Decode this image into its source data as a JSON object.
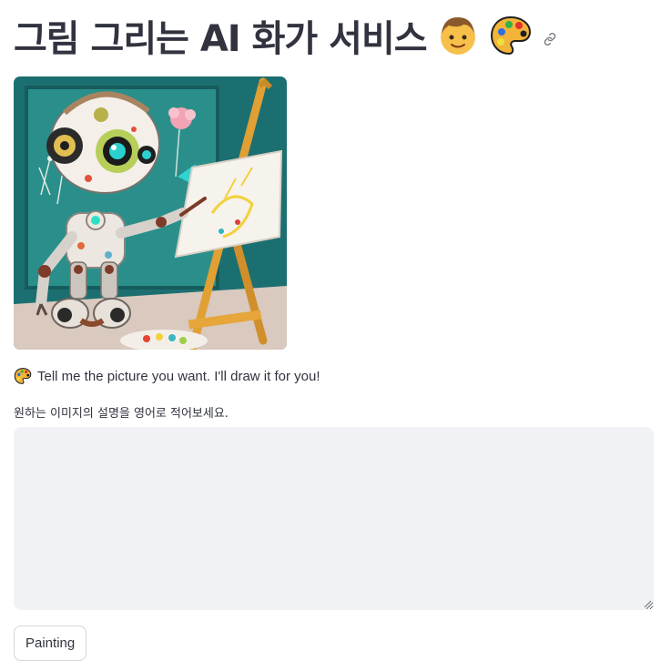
{
  "header": {
    "title": "그림 그리는 AI 화가 서비스",
    "icons": [
      "boy-face-emoji",
      "artist-palette-emoji",
      "link-icon"
    ]
  },
  "hero": {
    "image_subject": "robot-painting-at-easel",
    "colors": {
      "wall": "#1f7b7a",
      "floor": "#d8c8bd",
      "easel": "#e3a33b",
      "canvas": "#f6f3ef"
    }
  },
  "intro": {
    "icon": "artist-palette-emoji",
    "text": "Tell me the picture you want. I'll draw it for you!"
  },
  "prompt": {
    "label": "원하는 이미지의 설명을 영어로 적어보세요.",
    "value": "",
    "placeholder": ""
  },
  "actions": {
    "paint_label": "Painting"
  },
  "theme": {
    "text": "#31333f",
    "input_bg": "#f0f2f6",
    "button_border": "#d6d6d9"
  }
}
